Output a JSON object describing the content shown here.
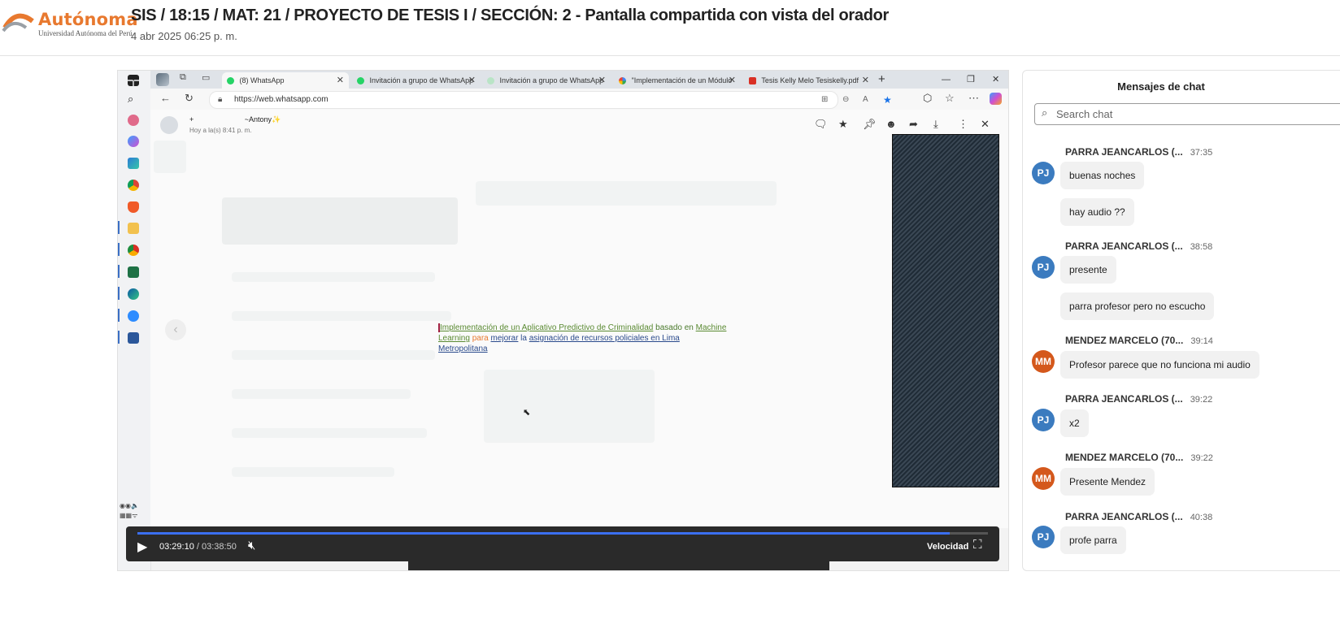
{
  "header": {
    "brand": "Autónoma",
    "brand_sub": "Universidad Autónoma del Perú",
    "title": "SIS / 18:15 / MAT: 21 / PROYECTO DE TESIS I / SECCIÓN: 2 - Pantalla compartida con vista del orador",
    "date": "4 abr 2025 06:25 p. m."
  },
  "browser": {
    "tabs": [
      {
        "label": "(8) WhatsApp",
        "icon": "whatsapp-icon",
        "active": true
      },
      {
        "label": "Invitación a grupo de WhatsApp",
        "icon": "whatsapp-icon"
      },
      {
        "label": "Invitación a grupo de WhatsApp",
        "icon": "whatsapp-icon"
      },
      {
        "label": "\"Implementación de un Módulo d",
        "icon": "google-icon"
      },
      {
        "label": "Tesis Kelly Melo Tesiskelly.pdf",
        "icon": "pdf-icon"
      }
    ],
    "url": "https://web.whatsapp.com"
  },
  "viewer": {
    "contact_prefix": "+",
    "contact_name": "~Antony✨",
    "contact_time": "Hoy a la(s) 8:41 p. m.",
    "caption": {
      "p1": "Implementación de un Aplicativo Predictivo de Criminalidad",
      "p2": " basado en ",
      "p3": "Machine Learning",
      "p4": " para ",
      "p5": "mejorar",
      "p6": " la ",
      "p7": "asignación de recursos policiales en Lima Metropolitana"
    }
  },
  "player": {
    "current": "03:29:10",
    "separator": "/",
    "total": "03:38:50",
    "progress": 0.955,
    "speed_label": "Velocidad"
  },
  "chat": {
    "title": "Mensajes de chat",
    "search_placeholder": "Search chat",
    "messages": [
      {
        "initials": "PJ",
        "name": "PARRA JEANCARLOS (...",
        "time": "37:35",
        "texts": [
          "buenas noches",
          "hay audio ??"
        ],
        "color": "#3b7bbf"
      },
      {
        "initials": "PJ",
        "name": "PARRA JEANCARLOS (...",
        "time": "38:58",
        "texts": [
          "presente",
          "parra profesor pero no escucho"
        ],
        "color": "#3b7bbf"
      },
      {
        "initials": "MM",
        "name": "MENDEZ MARCELO (70...",
        "time": "39:14",
        "texts": [
          "Profesor parece que no funciona mi audio"
        ],
        "color": "#d4581c"
      },
      {
        "initials": "PJ",
        "name": "PARRA JEANCARLOS (...",
        "time": "39:22",
        "texts": [
          "x2"
        ],
        "color": "#3b7bbf"
      },
      {
        "initials": "MM",
        "name": "MENDEZ MARCELO (70...",
        "time": "39:22",
        "texts": [
          "Presente Mendez"
        ],
        "color": "#d4581c"
      },
      {
        "initials": "PJ",
        "name": "PARRA JEANCARLOS (...",
        "time": "40:38",
        "texts": [
          "profe parra"
        ],
        "color": "#3b7bbf"
      }
    ]
  }
}
